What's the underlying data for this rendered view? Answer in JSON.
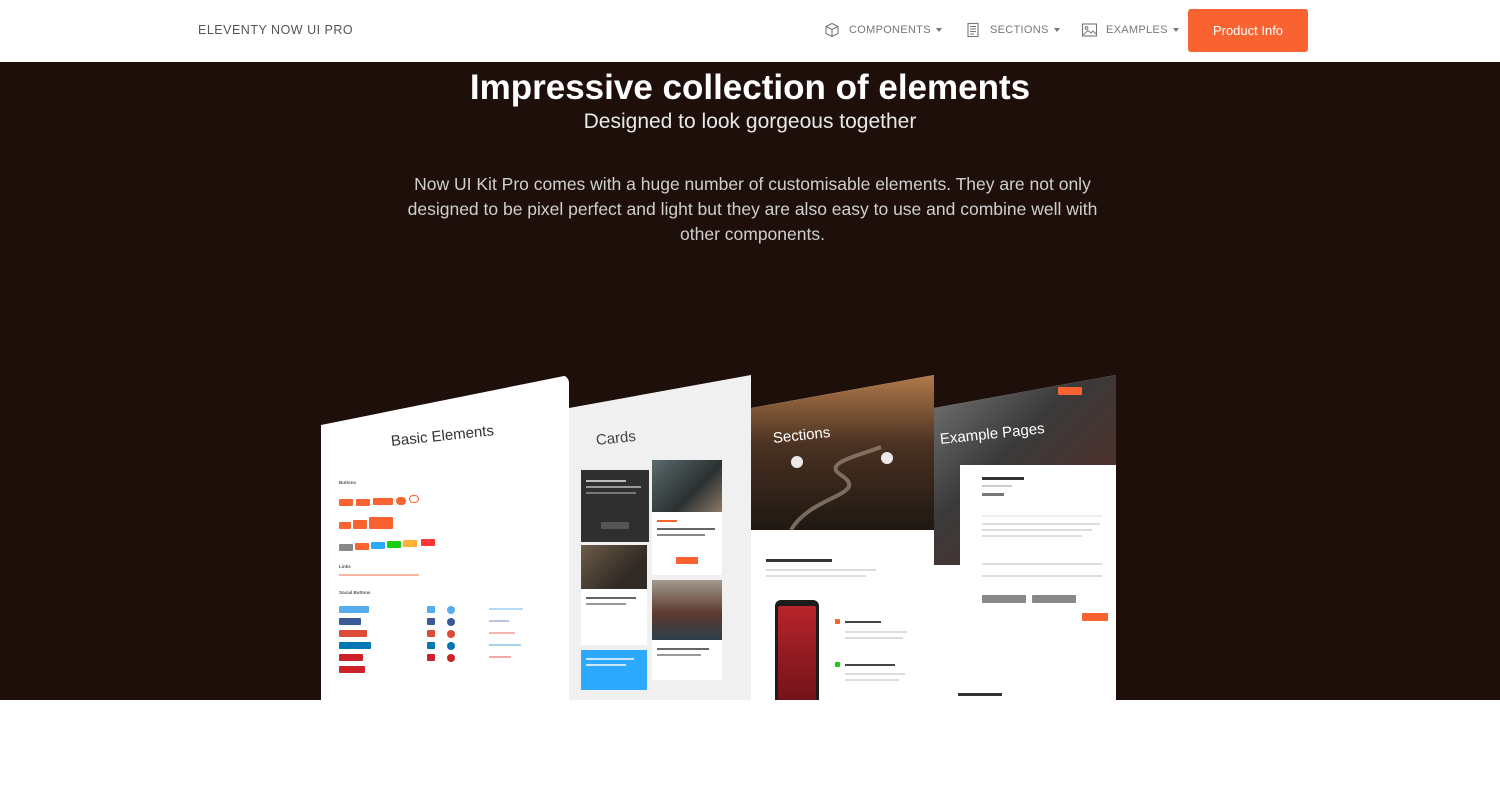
{
  "navbar": {
    "brand": "ELEVENTY NOW UI PRO",
    "items": [
      {
        "label": "COMPONENTS",
        "icon": "cube-icon"
      },
      {
        "label": "SECTIONS",
        "icon": "document-icon"
      },
      {
        "label": "EXAMPLES",
        "icon": "image-icon"
      }
    ],
    "cta": "Product Info"
  },
  "hero": {
    "title": "Impressive collection of elements",
    "subtitle": "Designed to look gorgeous together",
    "description": "Now UI Kit Pro comes with a huge number of customisable elements. They are not only designed to be pixel perfect and light but they are also easy to use and combine well with other components."
  },
  "panels": [
    {
      "title": "Basic Elements"
    },
    {
      "title": "Cards"
    },
    {
      "title": "Sections"
    },
    {
      "title": "Example Pages"
    }
  ],
  "colors": {
    "accent": "#f96332",
    "hero_bg": "#1e0f0b"
  }
}
